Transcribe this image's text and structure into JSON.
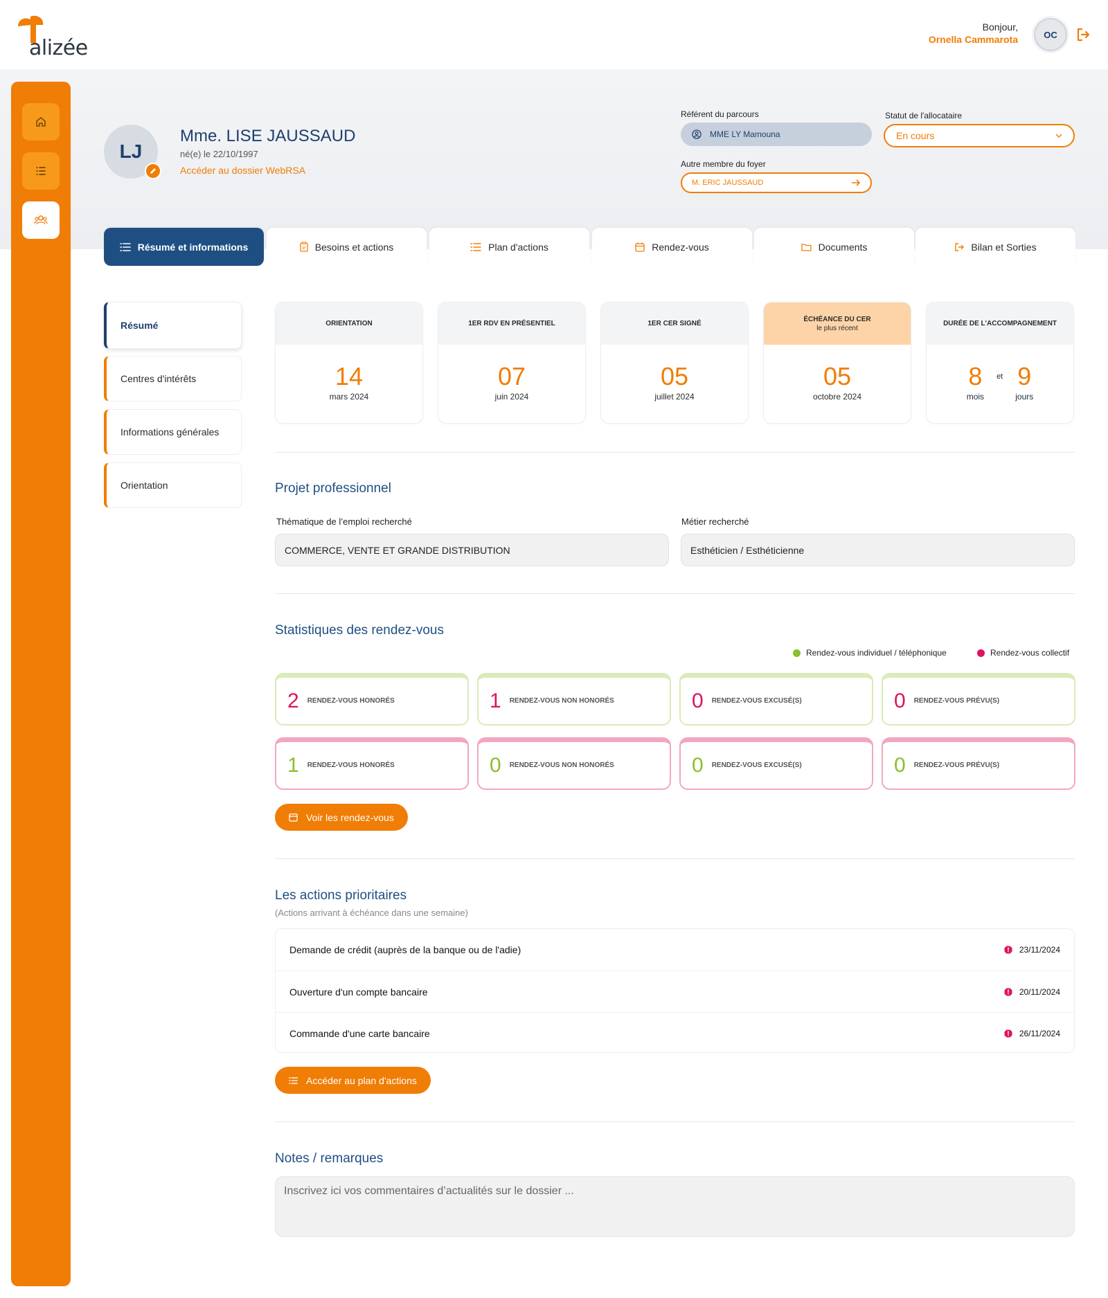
{
  "app": {
    "logo_text": "alizée",
    "brand_color": "#f07d05",
    "primary_color": "#1f4f82"
  },
  "header": {
    "greeting": "Bonjour,",
    "user_name": "Ornella Cammarota",
    "user_initials": "OC"
  },
  "sidebar": {
    "items": [
      {
        "icon": "home-icon"
      },
      {
        "icon": "list-icon"
      },
      {
        "icon": "users-icon",
        "active": true
      }
    ]
  },
  "profile": {
    "initials": "LJ",
    "name": "Mme. LISE JAUSSAUD",
    "birth": "né(e) le 22/10/1997",
    "webrsa_link": "Accéder au dossier WebRSA"
  },
  "fields": {
    "referent_label": "Référent du parcours",
    "referent_value": "MME LY Mamouna",
    "statut_label": "Statut de l'allocataire",
    "statut_value": "En cours",
    "autre_label": "Autre membre du foyer",
    "autre_value": "M. ERIC JAUSSAUD"
  },
  "tabs": [
    {
      "label": "Résumé et informations",
      "active": true
    },
    {
      "label": "Besoins et actions"
    },
    {
      "label": "Plan d'actions"
    },
    {
      "label": "Rendez-vous"
    },
    {
      "label": "Documents"
    },
    {
      "label": "Bilan et Sorties"
    }
  ],
  "submenu": [
    "Résumé",
    "Centres d'intérêts",
    "Informations générales",
    "Orientation"
  ],
  "kpis": [
    {
      "title": "ORIENTATION",
      "value": "14",
      "caption": "mars 2024"
    },
    {
      "title": "1ER RDV EN PRÉSENTIEL",
      "value": "07",
      "caption": "juin 2024"
    },
    {
      "title": "1ER CER SIGNÉ",
      "value": "05",
      "caption": "juillet 2024"
    },
    {
      "title": "ÉCHÉANCE DU CER",
      "subtitle": "le plus récent",
      "value": "05",
      "caption": "octobre 2024"
    },
    {
      "title": "DURÉE DE L'ACCOMPAGNEMENT",
      "value1": "8",
      "caption1": "mois",
      "connector": "et",
      "value2": "9",
      "caption2": "jours"
    }
  ],
  "projet": {
    "title": "Projet professionnel",
    "thematique_label": "Thématique de l’emploi recherché",
    "thematique_value": "COMMERCE, VENTE ET GRANDE DISTRIBUTION",
    "metier_label": "Métier recherché",
    "metier_value": "Esthéticien / Esthéticienne"
  },
  "stats": {
    "title": "Statistiques des rendez-vous",
    "legend_individuel": "Rendez-vous individuel / téléphonique",
    "legend_collectif": "Rendez-vous collectif",
    "individuel_color": "#8bbf2b",
    "collectif_color": "#e0115f",
    "individuel": [
      {
        "value": "2",
        "label": "RENDEZ-VOUS HONORÉS"
      },
      {
        "value": "1",
        "label": "RENDEZ-VOUS NON HONORÉS"
      },
      {
        "value": "0",
        "label": "RENDEZ-VOUS EXCUSÉ(S)"
      },
      {
        "value": "0",
        "label": "RENDEZ-VOUS PRÉVU(S)"
      }
    ],
    "collectif": [
      {
        "value": "1",
        "label": "RENDEZ-VOUS HONORÉS"
      },
      {
        "value": "0",
        "label": "RENDEZ-VOUS NON HONORÉS"
      },
      {
        "value": "0",
        "label": "RENDEZ-VOUS EXCUSÉ(S)"
      },
      {
        "value": "0",
        "label": "RENDEZ-VOUS PRÉVU(S)"
      }
    ],
    "button": "Voir les rendez-vous"
  },
  "actions": {
    "title": "Les actions prioritaires",
    "subtitle": "(Actions arrivant à échéance dans une semaine)",
    "items": [
      {
        "label": "Demande de crédit (auprès de la banque ou de l'adie)",
        "date": "23/11/2024"
      },
      {
        "label": "Ouverture d'un compte bancaire",
        "date": "20/11/2024"
      },
      {
        "label": "Commande d'une carte bancaire",
        "date": "26/11/2024"
      }
    ],
    "button": "Accéder au plan d'actions"
  },
  "notes": {
    "title": "Notes / remarques",
    "placeholder": "Inscrivez ici vos commentaires d’actualités sur le dossier ..."
  }
}
